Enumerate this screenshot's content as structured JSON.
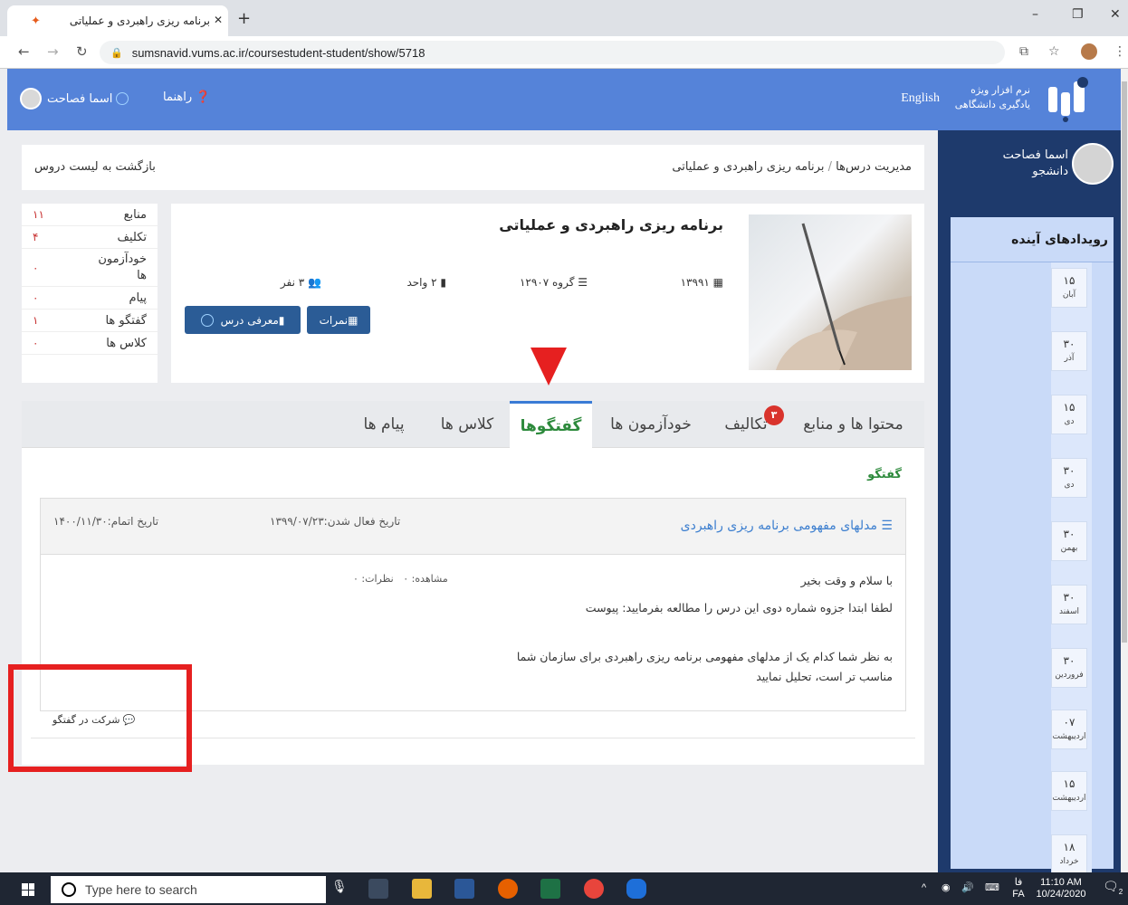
{
  "browser": {
    "tab_title": "برنامه ریزی راهبردی و عملیاتی",
    "url": "sumsnavid.vums.ac.ir/coursestudent-student/show/5718"
  },
  "header": {
    "logo_line1": "نرم افزار ویژه",
    "logo_line2": "یادگیری دانشگاهی",
    "lang": "English",
    "help": "راهنما",
    "user": "اسما فصاحت"
  },
  "sidebar": {
    "name": "اسما فصاحت",
    "role": "دانشجو",
    "events_title": "رویدادهای آینده",
    "events": [
      {
        "day": "۱۵",
        "month": "آبان"
      },
      {
        "day": "۳۰",
        "month": "آذر"
      },
      {
        "day": "۱۵",
        "month": "دی"
      },
      {
        "day": "۳۰",
        "month": "دی"
      },
      {
        "day": "۳۰",
        "month": "بهمن"
      },
      {
        "day": "۳۰",
        "month": "اسفند"
      },
      {
        "day": "۳۰",
        "month": "فروردین"
      },
      {
        "day": "۰۷",
        "month": "اردیبهشت"
      },
      {
        "day": "۱۵",
        "month": "اردیبهشت"
      },
      {
        "day": "۱۸",
        "month": "خرداد"
      }
    ]
  },
  "breadcrumb": {
    "root": "مدیریت درس‌ها",
    "sep": "/",
    "current": "برنامه ریزی راهبردی و عملیاتی",
    "back": "بازگشت به لیست دروس"
  },
  "stats": [
    {
      "label": "منابع",
      "value": "۱۱"
    },
    {
      "label": "تکلیف",
      "value": "۴"
    },
    {
      "label": "خودآزمون ها",
      "value": "۰"
    },
    {
      "label": "پیام",
      "value": "۰"
    },
    {
      "label": "گفتگو ها",
      "value": "۱"
    },
    {
      "label": "کلاس ها",
      "value": "۰"
    }
  ],
  "course": {
    "title": "برنامه ریزی راهبردی و عملیاتی",
    "year": "۱۳۹۹۱",
    "group": "گروه ۱۲۹۰۷",
    "units": "۲ واحد",
    "people": "۳ نفر",
    "btn_intro": "معرفی درس",
    "btn_grades": "نمرات"
  },
  "tabs": {
    "content": "محتوا ها و منابع",
    "assignments": "تکالیف",
    "assignments_badge": "۳",
    "quizzes": "خودآزمون ها",
    "discussions": "گفتگوها",
    "classes": "کلاس ها",
    "messages": "پیام ها"
  },
  "panel": {
    "section_title": "گفتگو",
    "post_title": "مدلهای مفهومی برنامه ریزی راهبردی",
    "active_date": "تاریخ فعال شدن:۱۳۹۹/۰۷/۲۳",
    "end_date": "تاریخ اتمام:۱۴۰۰/۱۱/۳۰",
    "views": "مشاهده: ۰",
    "comments": "نظرات: ۰",
    "line1": "با سلام و وقت بخیر",
    "line2": "لطفا ابتدا جزوه شماره دوی این درس را مطالعه بفرمایید: پیوست",
    "line3": "به نظر شما کدام یک از مدلهای مفهومی برنامه ریزی راهبردی برای سازمان شما",
    "line4": "مناسب تر است، تحلیل نمایید",
    "join": "شرکت در گفتگو"
  },
  "taskbar": {
    "search_placeholder": "Type here to search",
    "lang": "FA",
    "lang_top": "فا",
    "time": "11:10 AM",
    "date": "10/24/2020",
    "notif": "2"
  }
}
